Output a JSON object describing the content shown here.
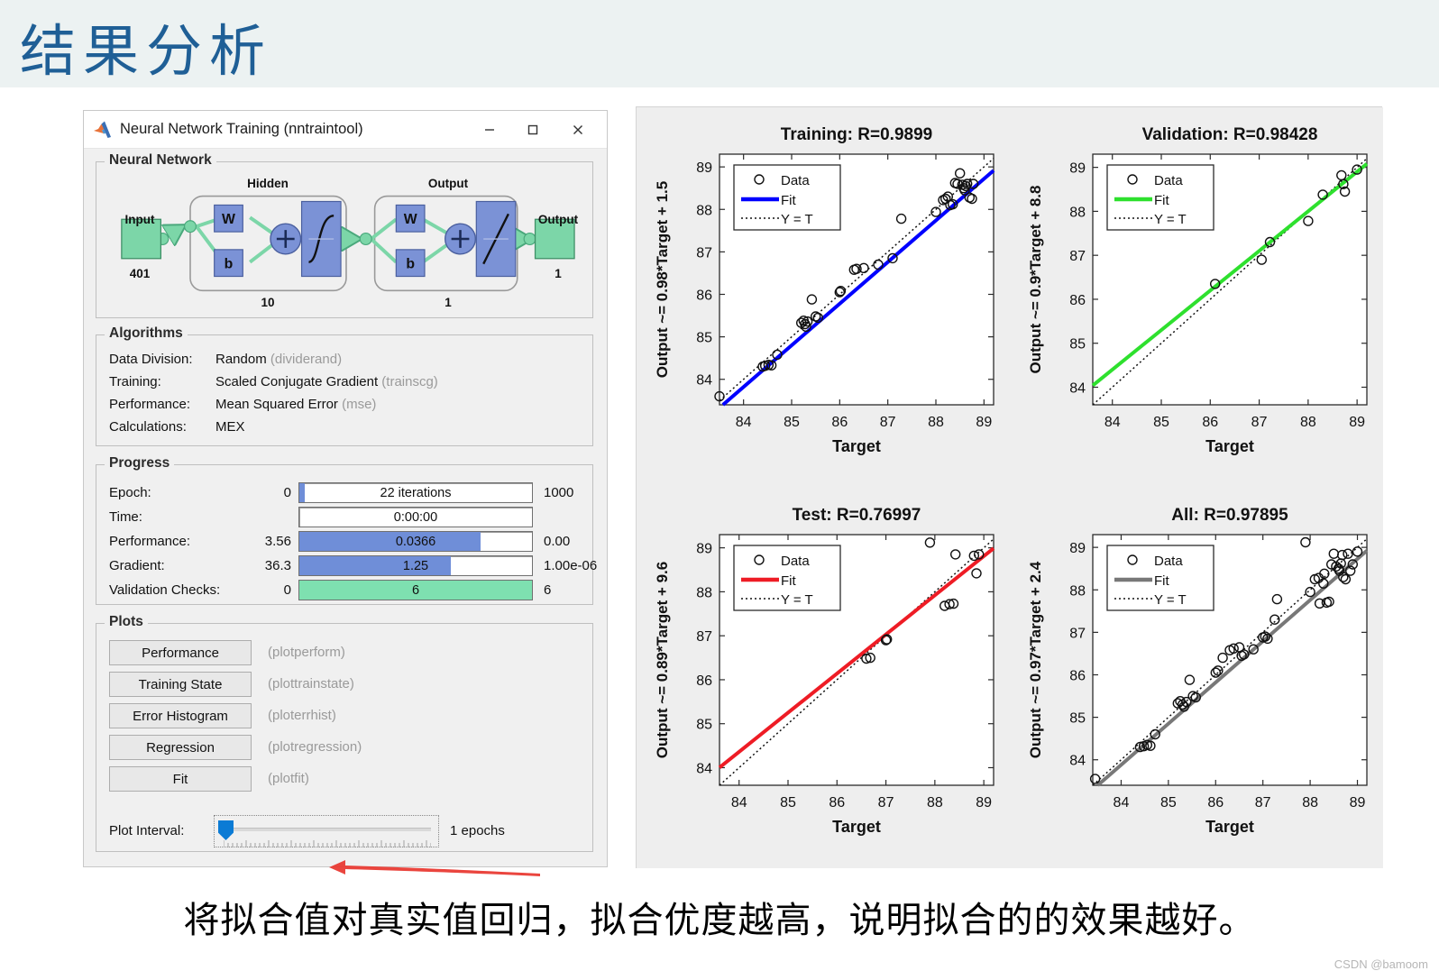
{
  "slide": {
    "title": "结果分析",
    "caption": "将拟合值对真实值回归，拟合优度越高，说明拟合的的效果越好。",
    "watermark": "CSDN @bamoom",
    "title_color": "#1f5f96",
    "header_bg": "#ecf2f2"
  },
  "window": {
    "title": "Neural Network Training (nntraintool)",
    "minimize_label": "—",
    "maximize_label": "□",
    "close_label": "✕"
  },
  "neural_network": {
    "group_title": "Neural Network",
    "input_label": "Input",
    "input_size": "401",
    "hidden_label": "Hidden",
    "hidden_size": "10",
    "output_layer_label": "Output",
    "output_layer_size": "1",
    "output_label": "Output",
    "output_size": "1",
    "weight_label": "W",
    "bias_label": "b",
    "sum_label": "+",
    "colors": {
      "block": "#7b92d6",
      "node": "#7cd6a8",
      "arrow": "#7cd6a8"
    }
  },
  "algorithms": {
    "group_title": "Algorithms",
    "rows": [
      {
        "key": "Data Division:",
        "value": "Random",
        "note": "(dividerand)"
      },
      {
        "key": "Training:",
        "value": "Scaled Conjugate Gradient",
        "note": "(trainscg)"
      },
      {
        "key": "Performance:",
        "value": "Mean Squared Error",
        "note": "(mse)"
      },
      {
        "key": "Calculations:",
        "value": "MEX",
        "note": ""
      }
    ]
  },
  "progress": {
    "group_title": "Progress",
    "rows": [
      {
        "label": "Epoch:",
        "left": "0",
        "bar_text": "22 iterations",
        "right": "1000",
        "fill_pct": 2.2,
        "fill_color": "#6f8ed8"
      },
      {
        "label": "Time:",
        "left": "",
        "bar_text": "0:00:00",
        "right": "",
        "fill_pct": 0,
        "fill_color": "#6f8ed8"
      },
      {
        "label": "Performance:",
        "left": "3.56",
        "bar_text": "0.0366",
        "right": "0.00",
        "fill_pct": 78,
        "fill_color": "#6f8ed8"
      },
      {
        "label": "Gradient:",
        "left": "36.3",
        "bar_text": "1.25",
        "right": "1.00e-06",
        "fill_pct": 65,
        "fill_color": "#6f8ed8"
      },
      {
        "label": "Validation Checks:",
        "left": "0",
        "bar_text": "6",
        "right": "6",
        "fill_pct": 100,
        "fill_color": "#7ee0b0"
      }
    ]
  },
  "plots_section": {
    "group_title": "Plots",
    "buttons": [
      {
        "label": "Performance",
        "fn": "(plotperform)"
      },
      {
        "label": "Training State",
        "fn": "(plottrainstate)"
      },
      {
        "label": "Error Histogram",
        "fn": "(ploterrhist)"
      },
      {
        "label": "Regression",
        "fn": "(plotregression)"
      },
      {
        "label": "Fit",
        "fn": "(plotfit)"
      }
    ],
    "interval_label": "Plot Interval:",
    "interval_value": "1 epochs",
    "annotation_color": "#e8352e",
    "annotation_target": "Regression"
  },
  "chart_data": [
    {
      "type": "scatter",
      "id": "training",
      "title": "Training: R=0.9899",
      "xlabel": "Target",
      "ylabel": "Output ~= 0.98*Target + 1.5",
      "xlim": [
        83.5,
        89.2
      ],
      "ylim": [
        83.4,
        89.3
      ],
      "xticks": [
        84,
        85,
        86,
        87,
        88,
        89
      ],
      "yticks": [
        84,
        85,
        86,
        87,
        88,
        89
      ],
      "legend": [
        "Data",
        "Fit",
        "Y = T"
      ],
      "legend_position": "upper left",
      "fit_color": "#0000ff",
      "fit_slope": 0.98,
      "fit_intercept": 1.5,
      "r_value": 0.9899,
      "points": [
        [
          83.5,
          83.6
        ],
        [
          84.4,
          84.3
        ],
        [
          84.45,
          84.32
        ],
        [
          84.52,
          84.34
        ],
        [
          84.58,
          84.33
        ],
        [
          84.7,
          84.58
        ],
        [
          85.2,
          85.33
        ],
        [
          85.25,
          85.38
        ],
        [
          85.28,
          85.3
        ],
        [
          85.3,
          85.24
        ],
        [
          85.33,
          85.36
        ],
        [
          85.42,
          85.88
        ],
        [
          85.5,
          85.48
        ],
        [
          85.55,
          85.45
        ],
        [
          86.0,
          86.05
        ],
        [
          86.02,
          86.08
        ],
        [
          86.3,
          86.58
        ],
        [
          86.35,
          86.6
        ],
        [
          86.5,
          86.62
        ],
        [
          86.8,
          86.7
        ],
        [
          87.1,
          86.85
        ],
        [
          87.28,
          87.78
        ],
        [
          88.0,
          87.94
        ],
        [
          88.15,
          88.22
        ],
        [
          88.2,
          88.25
        ],
        [
          88.25,
          88.3
        ],
        [
          88.3,
          88.1
        ],
        [
          88.35,
          88.12
        ],
        [
          88.4,
          88.62
        ],
        [
          88.45,
          88.6
        ],
        [
          88.5,
          88.85
        ],
        [
          88.55,
          88.58
        ],
        [
          88.58,
          88.5
        ],
        [
          88.6,
          88.45
        ],
        [
          88.62,
          88.55
        ],
        [
          88.65,
          88.6
        ],
        [
          88.7,
          88.28
        ],
        [
          88.75,
          88.25
        ],
        [
          88.78,
          88.6
        ]
      ]
    },
    {
      "type": "scatter",
      "id": "validation",
      "title": "Validation: R=0.98428",
      "xlabel": "Target",
      "ylabel": "Output ~= 0.9*Target + 8.8",
      "xlim": [
        83.6,
        89.2
      ],
      "ylim": [
        83.6,
        89.3
      ],
      "xticks": [
        84,
        85,
        86,
        87,
        88,
        89
      ],
      "yticks": [
        84,
        85,
        86,
        87,
        88,
        89
      ],
      "legend": [
        "Data",
        "Fit",
        "Y = T"
      ],
      "legend_position": "upper left",
      "fit_color": "#2ee02e",
      "fit_slope": 0.9,
      "fit_intercept": 8.8,
      "r_value": 0.98428,
      "points": [
        [
          86.1,
          86.35
        ],
        [
          87.05,
          86.9
        ],
        [
          87.22,
          87.3
        ],
        [
          88.0,
          87.78
        ],
        [
          88.3,
          88.38
        ],
        [
          88.68,
          88.82
        ],
        [
          88.72,
          88.62
        ],
        [
          88.75,
          88.45
        ],
        [
          89.0,
          88.95
        ]
      ]
    },
    {
      "type": "scatter",
      "id": "test",
      "title": "Test: R=0.76997",
      "xlabel": "Target",
      "ylabel": "Output ~= 0.89*Target + 9.6",
      "xlim": [
        83.6,
        89.2
      ],
      "ylim": [
        83.6,
        89.3
      ],
      "xticks": [
        84,
        85,
        86,
        87,
        88,
        89
      ],
      "yticks": [
        84,
        85,
        86,
        87,
        88,
        89
      ],
      "legend": [
        "Data",
        "Fit",
        "Y = T"
      ],
      "legend_position": "upper left",
      "fit_color": "#ee1c25",
      "fit_slope": 0.89,
      "fit_intercept": 9.6,
      "r_value": 0.76997,
      "points": [
        [
          86.6,
          86.48
        ],
        [
          86.68,
          86.5
        ],
        [
          87.0,
          86.9
        ],
        [
          87.02,
          86.92
        ],
        [
          88.2,
          87.68
        ],
        [
          88.3,
          87.72
        ],
        [
          88.38,
          87.73
        ],
        [
          87.9,
          89.12
        ],
        [
          88.42,
          88.85
        ],
        [
          88.8,
          88.82
        ],
        [
          88.85,
          88.42
        ],
        [
          88.9,
          88.85
        ]
      ]
    },
    {
      "type": "scatter",
      "id": "all",
      "title": "All: R=0.97895",
      "xlabel": "Target",
      "ylabel": "Output ~= 0.97*Target + 2.4",
      "xlim": [
        83.4,
        89.2
      ],
      "ylim": [
        83.4,
        89.3
      ],
      "xticks": [
        84,
        85,
        86,
        87,
        88,
        89
      ],
      "yticks": [
        84,
        85,
        86,
        87,
        88,
        89
      ],
      "legend": [
        "Data",
        "Fit",
        "Y = T"
      ],
      "legend_position": "upper left",
      "fit_color": "#787878",
      "fit_slope": 0.97,
      "fit_intercept": 2.4,
      "r_value": 0.97895,
      "points": [
        [
          83.45,
          83.55
        ],
        [
          84.4,
          84.3
        ],
        [
          84.48,
          84.32
        ],
        [
          84.55,
          84.35
        ],
        [
          84.62,
          84.33
        ],
        [
          84.72,
          84.6
        ],
        [
          85.2,
          85.33
        ],
        [
          85.25,
          85.38
        ],
        [
          85.3,
          85.3
        ],
        [
          85.33,
          85.25
        ],
        [
          85.38,
          85.36
        ],
        [
          85.45,
          85.88
        ],
        [
          85.52,
          85.5
        ],
        [
          85.58,
          85.47
        ],
        [
          86.0,
          86.05
        ],
        [
          86.05,
          86.1
        ],
        [
          86.15,
          86.4
        ],
        [
          86.3,
          86.58
        ],
        [
          86.38,
          86.62
        ],
        [
          86.5,
          86.65
        ],
        [
          86.55,
          86.45
        ],
        [
          86.6,
          86.48
        ],
        [
          86.8,
          86.6
        ],
        [
          87.0,
          86.88
        ],
        [
          87.05,
          86.9
        ],
        [
          87.1,
          86.85
        ],
        [
          87.25,
          87.3
        ],
        [
          87.3,
          87.78
        ],
        [
          87.9,
          89.12
        ],
        [
          88.0,
          87.95
        ],
        [
          88.1,
          88.25
        ],
        [
          88.18,
          88.28
        ],
        [
          88.2,
          87.68
        ],
        [
          88.28,
          88.15
        ],
        [
          88.3,
          88.38
        ],
        [
          88.35,
          87.7
        ],
        [
          88.4,
          87.72
        ],
        [
          88.45,
          88.6
        ],
        [
          88.5,
          88.85
        ],
        [
          88.55,
          88.55
        ],
        [
          88.6,
          88.5
        ],
        [
          88.62,
          88.45
        ],
        [
          88.65,
          88.62
        ],
        [
          88.68,
          88.82
        ],
        [
          88.7,
          88.3
        ],
        [
          88.75,
          88.25
        ],
        [
          88.8,
          88.85
        ],
        [
          88.85,
          88.45
        ],
        [
          88.9,
          88.6
        ],
        [
          89.0,
          88.9
        ]
      ]
    }
  ]
}
